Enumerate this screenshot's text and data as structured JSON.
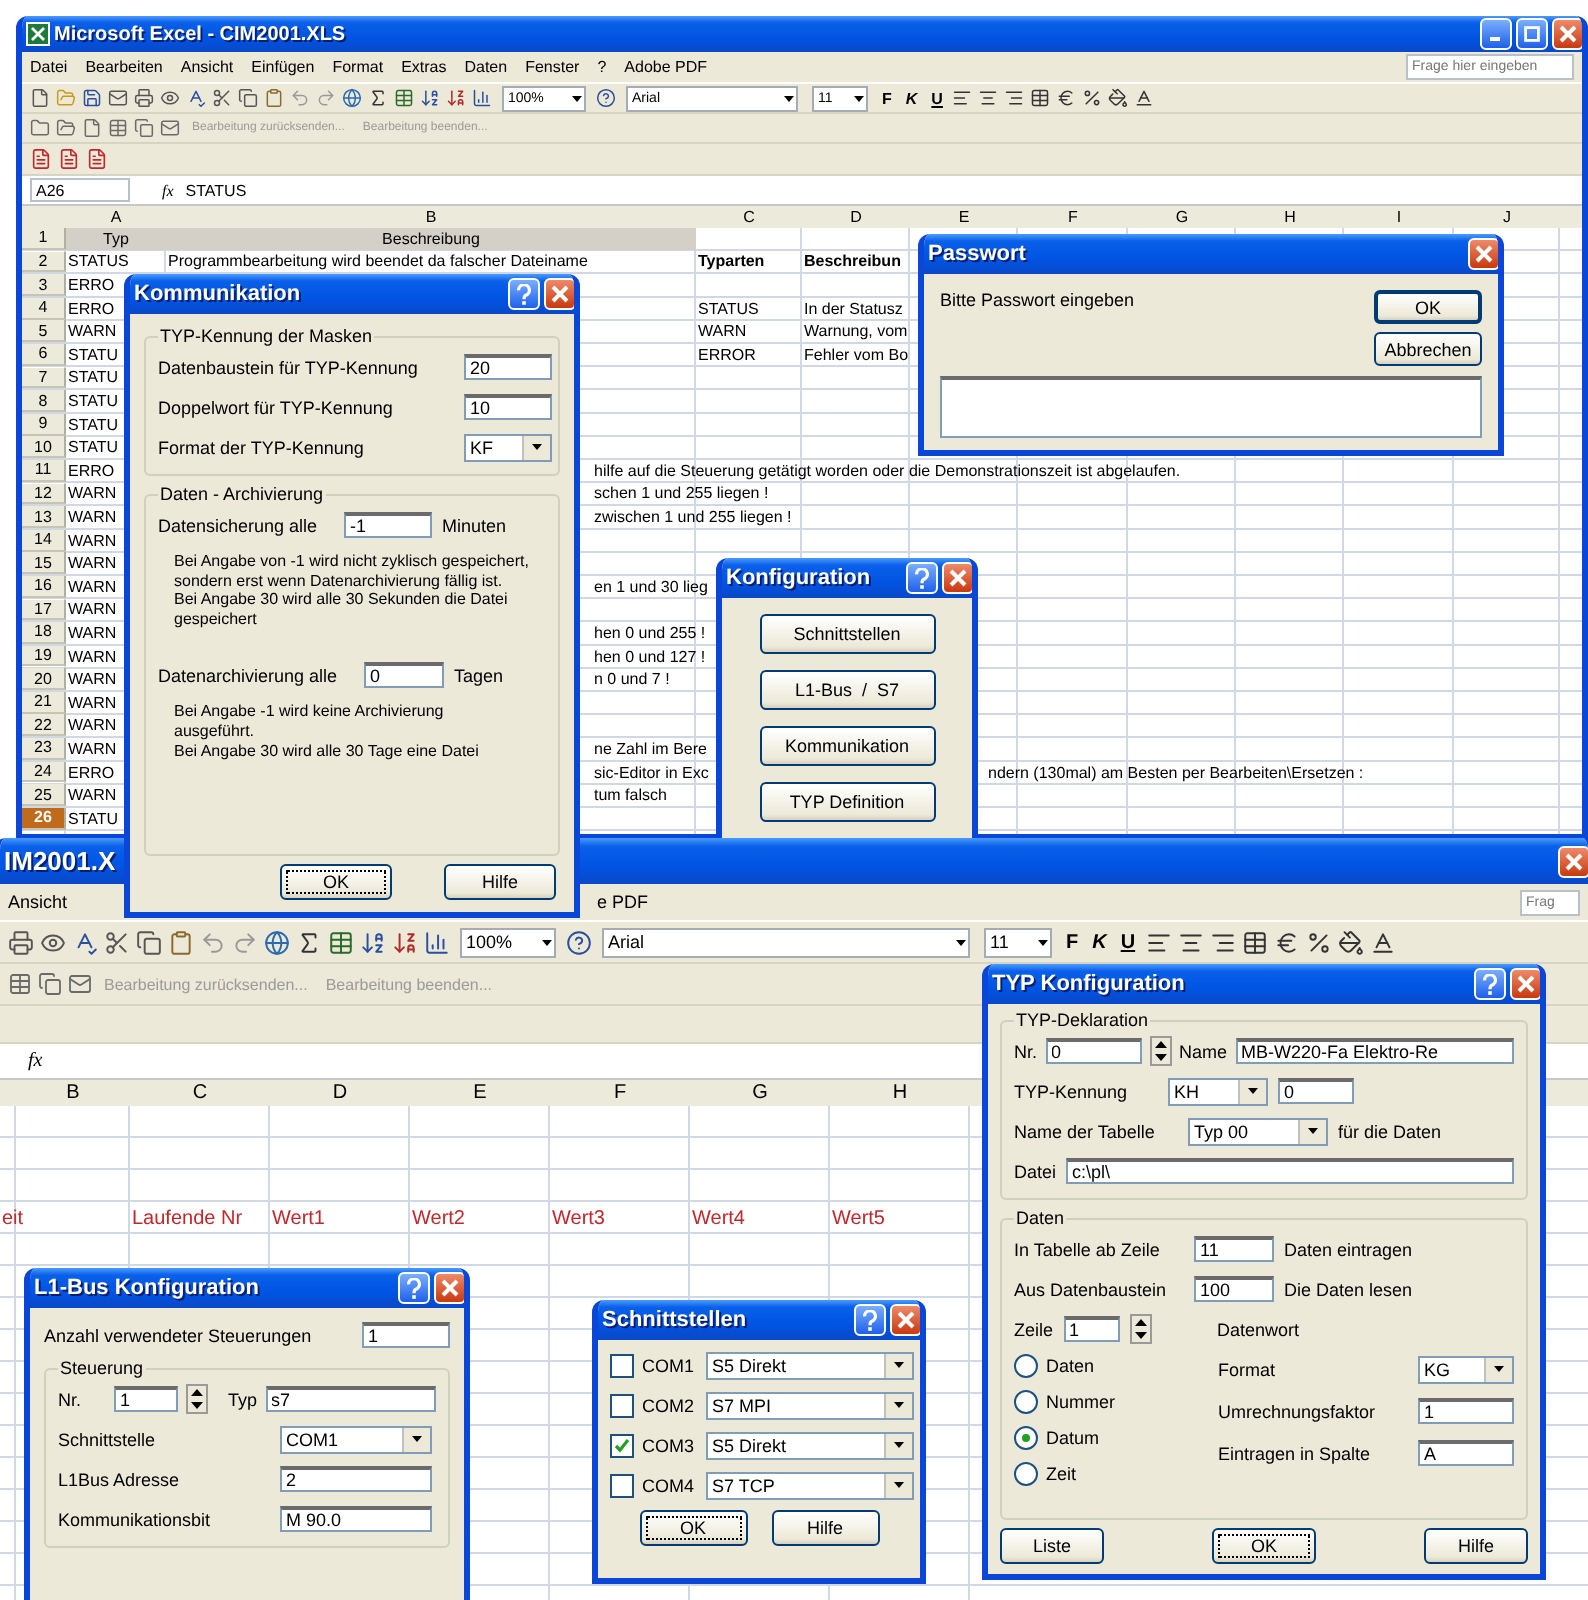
{
  "excel_top": {
    "title": "Microsoft Excel - CIM2001.XLS",
    "menu": [
      "Datei",
      "Bearbeiten",
      "Ansicht",
      "Einfügen",
      "Format",
      "Extras",
      "Daten",
      "Fenster",
      "?",
      "Adobe PDF"
    ],
    "help_search": {
      "placeholder": "Frage hier eingeben"
    },
    "zoom": "100%",
    "font": "Arial",
    "font_size": "11",
    "style_buttons": [
      "F",
      "K",
      "U"
    ],
    "review_actions": [
      {
        "label": "Bearbeitung zurücksenden...",
        "disabled": true
      },
      {
        "label": "Bearbeitung beenden...",
        "disabled": true
      }
    ],
    "name_box": "A26",
    "function_label": "fx",
    "formula": "STATUS",
    "columns": [
      "A",
      "B",
      "C",
      "D",
      "E",
      "F",
      "G",
      "H",
      "I",
      "J"
    ],
    "rows": [
      {
        "num": "1",
        "kind": "heading",
        "selected": false,
        "a": "Typ",
        "b": "Beschreibung"
      },
      {
        "num": "2",
        "kind": "caption",
        "selected": false,
        "a": "STATUS",
        "b": "Programmbearbeitung wird beendet da falscher Dateiname",
        "c": "Typarten",
        "d": "Beschreibun"
      },
      {
        "num": "3",
        "kind": "data",
        "selected": false,
        "a": "ERRO"
      },
      {
        "num": "4",
        "kind": "data",
        "selected": false,
        "a": "ERRO",
        "c": "STATUS",
        "d": "In der Statusz"
      },
      {
        "num": "5",
        "kind": "data",
        "selected": false,
        "a": "WARN",
        "c": "WARN",
        "d": "Warnung, vom"
      },
      {
        "num": "6",
        "kind": "data",
        "selected": false,
        "a": "STATU",
        "c": "ERROR",
        "d": "Fehler vom Bo"
      },
      {
        "num": "7",
        "kind": "data",
        "selected": false,
        "a": "STATU"
      },
      {
        "num": "8",
        "kind": "data",
        "selected": false,
        "a": "STATU"
      },
      {
        "num": "9",
        "kind": "data",
        "selected": false,
        "a": "STATU"
      },
      {
        "num": "10",
        "kind": "data",
        "selected": false,
        "a": "STATU"
      },
      {
        "num": "11",
        "kind": "data",
        "selected": false,
        "a": "ERRO",
        "b_tail": "hilfe auf die Steuerung getätigt worden oder die Demonstrationszeit ist abgelaufen."
      },
      {
        "num": "12",
        "kind": "data",
        "selected": false,
        "a": "WARN",
        "b_tail": "schen 1 und 255 liegen !"
      },
      {
        "num": "13",
        "kind": "data",
        "selected": false,
        "a": "WARN",
        "b_tail": "zwischen 1 und 255 liegen !"
      },
      {
        "num": "14",
        "kind": "data",
        "selected": false,
        "a": "WARN"
      },
      {
        "num": "15",
        "kind": "data",
        "selected": false,
        "a": "WARN"
      },
      {
        "num": "16",
        "kind": "data",
        "selected": false,
        "a": "WARN",
        "b_tail": "en 1 und 30 lieg"
      },
      {
        "num": "17",
        "kind": "data",
        "selected": false,
        "a": "WARN"
      },
      {
        "num": "18",
        "kind": "data",
        "selected": false,
        "a": "WARN",
        "b_tail": "hen 0 und 255 !"
      },
      {
        "num": "19",
        "kind": "data",
        "selected": false,
        "a": "WARN",
        "b_tail": "hen 0 und 127 !"
      },
      {
        "num": "20",
        "kind": "data",
        "selected": false,
        "a": "WARN",
        "b_tail": "n 0 und 7 !"
      },
      {
        "num": "21",
        "kind": "data",
        "selected": false,
        "a": "WARN"
      },
      {
        "num": "22",
        "kind": "data",
        "selected": false,
        "a": "WARN"
      },
      {
        "num": "23",
        "kind": "data",
        "selected": false,
        "a": "WARN",
        "b_tail": "ne Zahl im Bere"
      },
      {
        "num": "24",
        "kind": "data",
        "selected": false,
        "a": "ERRO",
        "b_tail": "sic-Editor in Exc",
        "e_tail": "ndern (130mal) am Besten per Bearbeiten\\Ersetzen :"
      },
      {
        "num": "25",
        "kind": "data",
        "selected": false,
        "a": "WARN",
        "b_tail": "tum falsch"
      },
      {
        "num": "26",
        "kind": "data",
        "selected": true,
        "a": "STATU"
      }
    ]
  },
  "konfiguration": {
    "title": "Konfiguration",
    "buttons": [
      "Schnittstellen",
      "L1-Bus  /  S7",
      "Kommunikation",
      "TYP Definition"
    ]
  },
  "passwort": {
    "title": "Passwort",
    "prompt": "Bitte Passwort eingeben",
    "buttons": [
      {
        "label": "OK",
        "default": true
      },
      {
        "label": "Abbrechen",
        "default": false
      }
    ]
  },
  "excel_bottom": {
    "title": "IM2001.X",
    "menu": [
      "Ansicht",
      "e PDF"
    ],
    "help_search": {
      "placeholder": "Frag"
    },
    "zoom": "100%",
    "font": "Arial",
    "font_size": "11",
    "style_buttons": [
      "F",
      "K",
      "U"
    ],
    "review_actions": [
      {
        "label": "Bearbeitung zurücksenden...",
        "disabled": true
      },
      {
        "label": "Bearbeitung beenden...",
        "disabled": true
      }
    ],
    "function_label": "fx",
    "columns": [
      "B",
      "C",
      "D",
      "E",
      "F",
      "G",
      "H"
    ],
    "label_row": {
      "cut": "eit",
      "cells": [
        "Laufende Nr",
        "Wert1",
        "Wert2",
        "Wert3",
        "Wert4",
        "Wert5"
      ]
    }
  },
  "kommunikation": {
    "title": "Kommunikation",
    "masks": {
      "label": "TYP-Kennung der Masken",
      "fields": [
        {
          "label": "Datenbaustein für TYP-Kennung",
          "kind": "input",
          "value": "20"
        },
        {
          "label": "Doppelwort für TYP-Kennung",
          "kind": "input",
          "value": "10"
        },
        {
          "label": "Format der TYP-Kennung",
          "kind": "select",
          "value": "KF"
        }
      ]
    },
    "archive": {
      "label": "Daten - Archivierung",
      "backup": {
        "label": "Datensicherung alle",
        "value": "-1",
        "unit": "Minuten"
      },
      "backup_note": "Bei Angabe von -1 wird nicht zyklisch gespeichert,\nsondern erst wenn Datenarchivierung fällig ist.\nBei Angabe 30 wird alle 30 Sekunden die Datei\ngespeichert",
      "archiving": {
        "label": "Datenarchivierung alle",
        "value": "0",
        "unit": "Tagen"
      },
      "archiving_note": "Bei Angabe -1 wird keine Archivierung\nausgeführt.\nBei Angabe 30 wird alle 30 Tage eine Datei"
    },
    "buttons": [
      {
        "label": "OK",
        "focused": true
      },
      {
        "label": "Hilfe",
        "focused": false
      }
    ]
  },
  "typ": {
    "title": "TYP Konfiguration",
    "declaration": {
      "label": "TYP-Deklaration",
      "nr_label": "Nr.",
      "nr": "0",
      "name_label": "Name",
      "name": "MB-W220-Fa Elektro-Re",
      "kennung_label": "TYP-Kennung",
      "kennung": "KH",
      "kennung_value": "0",
      "table_label": "Name der Tabelle",
      "table": "Typ 00",
      "table_suffix": "für die Daten",
      "file_label": "Datei",
      "file": "c:\\pl\\"
    },
    "data": {
      "label": "Daten",
      "row_label": "In Tabelle ab Zeile",
      "row": "11",
      "row_suffix": "Daten eintragen",
      "block_label": "Aus Datenbaustein",
      "block": "100",
      "block_suffix": "Die Daten lesen",
      "line_label": "Zeile",
      "line": "1",
      "word_label": "Datenwort",
      "options": [
        {
          "label": "Daten",
          "selected": false
        },
        {
          "label": "Nummer",
          "selected": false
        },
        {
          "label": "Datum",
          "selected": true
        },
        {
          "label": "Zeit",
          "selected": false
        }
      ],
      "format_label": "Format",
      "format": "KG",
      "factor_label": "Umrechnungsfaktor",
      "factor": "1",
      "column_label": "Eintragen in Spalte",
      "column": "A"
    },
    "buttons": [
      {
        "label": "Liste",
        "focused": false
      },
      {
        "label": "OK",
        "focused": true
      },
      {
        "label": "Hilfe",
        "focused": false
      }
    ]
  },
  "l1bus": {
    "title": "L1-Bus Konfiguration",
    "count_label": "Anzahl verwendeter Steuerungen",
    "count": "1",
    "group": {
      "label": "Steuerung",
      "nr_label": "Nr.",
      "nr": "1",
      "typ_label": "Typ",
      "typ": "s7",
      "port_label": "Schnittstelle",
      "port": "COM1",
      "address_label": "L1Bus Adresse",
      "address": "2",
      "bit_label": "Kommunikationsbit",
      "bit": "M 90.0"
    }
  },
  "schnittstellen": {
    "title": "Schnittstellen",
    "ports": [
      {
        "label": "COM1",
        "checked": false,
        "driver": "S5 Direkt"
      },
      {
        "label": "COM2",
        "checked": false,
        "driver": "S7 MPI"
      },
      {
        "label": "COM3",
        "checked": true,
        "driver": "S5 Direkt"
      },
      {
        "label": "COM4",
        "checked": false,
        "driver": "S7 TCP"
      }
    ],
    "buttons": [
      {
        "label": "OK",
        "focused": true
      },
      {
        "label": "Hilfe",
        "focused": false
      }
    ]
  }
}
